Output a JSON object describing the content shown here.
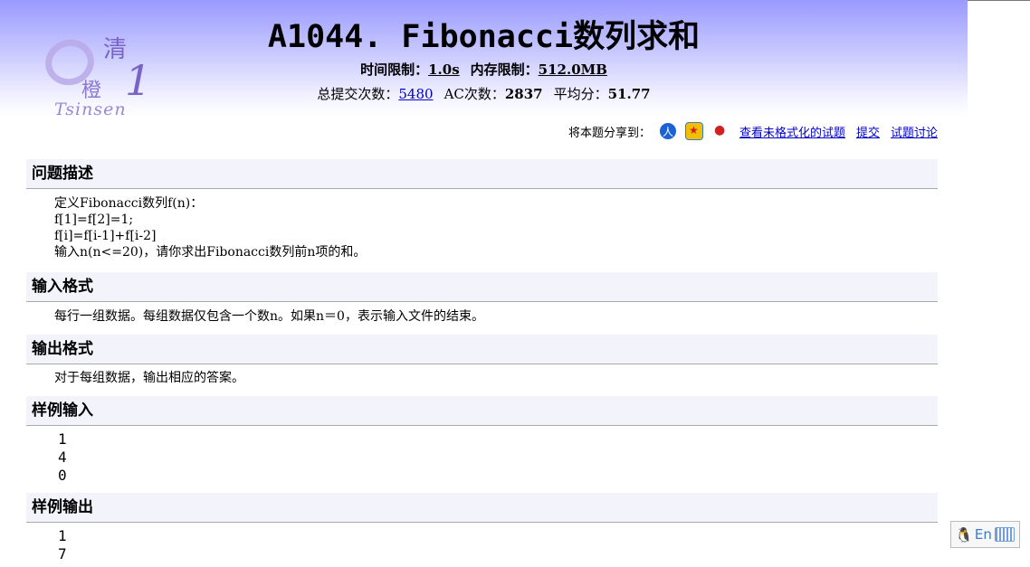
{
  "problem": {
    "title": "A1044. Fibonacci数列求和",
    "time_limit_label": "时间限制：",
    "time_limit": "1.0s",
    "memory_limit_label": "内存限制：",
    "memory_limit": "512.0MB",
    "submissions_label": "总提交次数：",
    "submissions": "5480",
    "ac_label": "AC次数：",
    "ac": "2837",
    "avg_label": "平均分：",
    "avg": "51.77"
  },
  "logo": {
    "char1": "清",
    "char2": "橙",
    "char3": "1",
    "text": "Tsinsen"
  },
  "share": {
    "label": "将本题分享到：",
    "icons": [
      "renren-icon",
      "qzone-icon",
      "weibo-icon"
    ],
    "unformatted_link": "查看未格式化的试题",
    "submit_link": "提交",
    "discuss_link": "试题讨论"
  },
  "sections": {
    "description": {
      "heading": "问题描述",
      "lines": [
        "定义Fibonacci数列f(n)：",
        "f[1]=f[2]=1;",
        "f[i]=f[i-1]+f[i-2]",
        "输入n(n<=20)，请你求出Fibonacci数列前n项的和。"
      ]
    },
    "input_format": {
      "heading": "输入格式",
      "text": "每行一组数据。每组数据仅包含一个数n。如果n＝0，表示输入文件的结束。"
    },
    "output_format": {
      "heading": "输出格式",
      "text": "对于每组数据，输出相应的答案。"
    },
    "sample_input": {
      "heading": "样例输入",
      "lines": [
        "1",
        "4",
        "0"
      ]
    },
    "sample_output": {
      "heading": "样例输出",
      "lines": [
        "1",
        "7"
      ]
    }
  },
  "ime": {
    "penguin": "🐧",
    "lang": "En"
  }
}
